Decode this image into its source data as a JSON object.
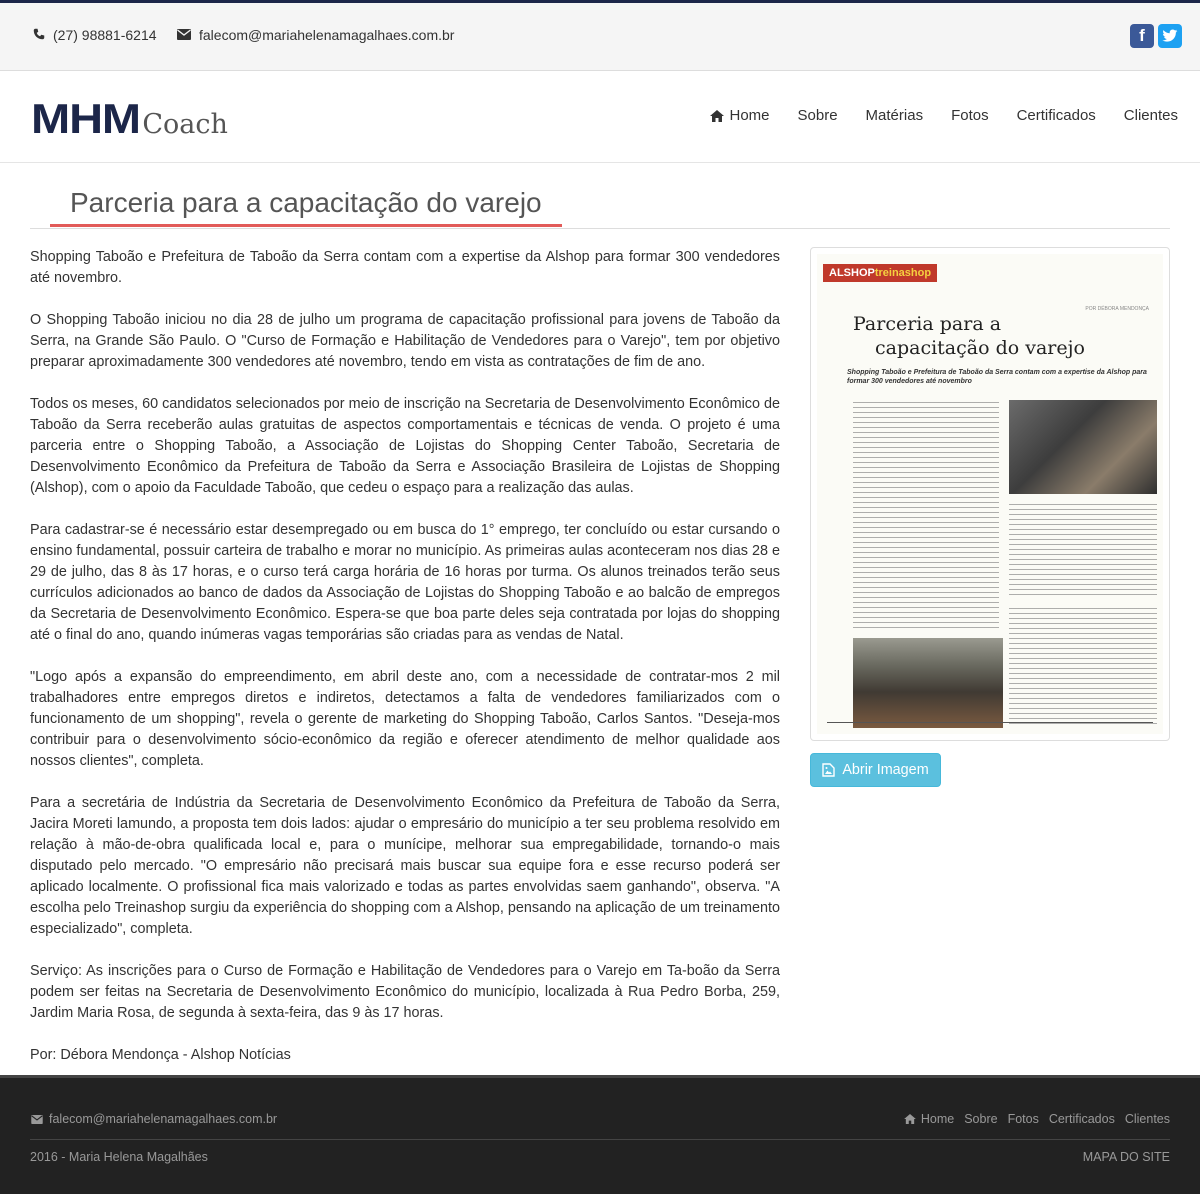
{
  "topbar": {
    "phone": "(27) 98881-6214",
    "email": "falecom@mariahelenamagalhaes.com.br",
    "social": [
      "facebook-icon",
      "twitter-icon"
    ],
    "colors": {
      "facebook": "#3b5998",
      "twitter": "#1da1f2"
    }
  },
  "logo": {
    "mark": "MHM",
    "text": "Coach"
  },
  "nav": {
    "items": [
      {
        "label": "Home",
        "icon": "home-icon"
      },
      {
        "label": "Sobre"
      },
      {
        "label": "Matérias"
      },
      {
        "label": "Fotos"
      },
      {
        "label": "Certificados"
      },
      {
        "label": "Clientes"
      }
    ]
  },
  "page": {
    "title": "Parceria para a capacitação do varejo",
    "paragraphs": [
      "Shopping Taboão e Prefeitura de Taboão da Serra contam com a expertise da Alshop para formar 300 vendedores até novembro.",
      "O Shopping Taboão iniciou no dia 28 de julho um programa de capacitação profissional para jovens de Taboão da Serra, na Grande São Paulo. O \"Curso de Formação e Habilitação de Vendedores para o Varejo\", tem por objetivo preparar aproximadamente 300 vendedores até novembro, tendo em vista as contratações de fim de ano.",
      "Todos os meses, 60 candidatos selecionados por meio de inscrição na Secretaria de Desenvolvimento Econômico de Taboão da Serra receberão aulas gratuitas de aspectos comportamentais e técnicas de venda. O projeto é uma parceria entre o Shopping Taboão, a Associação de Lojistas do Shopping Center Taboão, Secretaria de Desenvolvimento Econômico da Prefeitura de Taboão da Serra e Associação Brasileira de Lojistas de Shopping (Alshop), com o apoio da Faculdade Taboão, que cedeu o espaço para a realização das aulas.",
      "Para cadastrar-se é necessário estar desempregado ou em busca do 1° emprego, ter concluído ou estar cursando o ensino fundamental, possuir carteira de trabalho e morar no município. As primeiras aulas aconteceram nos dias 28 e 29 de julho, das 8 às 17 horas, e o curso terá carga horária de 16 horas por turma. Os alunos treinados terão seus currículos adicionados ao banco de dados da Associação de Lojistas do Shopping Taboão e ao balcão de empregos da Secretaria de Desenvolvimento Econômico. Espera-se que boa parte deles seja contratada por lojas do shopping até o final do ano, quando inúmeras vagas temporárias são criadas para as vendas de Natal.",
      "\"Logo após a expansão do empreendimento, em abril deste ano, com a necessidade de contratar-mos 2 mil trabalhadores entre empregos diretos e indiretos, detectamos a falta de vendedores familiarizados com o funcionamento de um shopping\", revela o gerente de marketing do Shopping Taboão, Carlos Santos. \"Deseja-mos contribuir para o desenvolvimento sócio-econômico da região e oferecer atendimento de melhor qualidade aos nossos clientes\", completa.",
      "Para a secretária de Indústria da Secretaria de Desenvolvimento Econômico da Prefeitura de Taboão da Serra, Jacira Moreti lamundo, a proposta tem dois lados: ajudar o empresário do município a ter seu problema resolvido em relação à mão-de-obra qualificada local e, para o munícipe, melhorar sua empregabilidade, tornando-o mais disputado pelo mercado. \"O empresário não precisará mais buscar sua equipe fora e esse recurso poderá ser aplicado localmente. O profissional fica mais valorizado e todas as partes envolvidas saem ganhando\", observa. \"A escolha pelo Treinashop surgiu da experiência do shopping com a Alshop, pensando na aplicação de um treinamento especializado\", completa.",
      "Serviço: As inscrições para o Curso de Formação e Habilitação de Vendedores para o Varejo em Ta-boão da Serra podem ser feitas na Secretaria de Desenvolvimento Econômico do município, localizada à Rua Pedro Borba, 259, Jardim Maria Rosa, de segunda à sexta-feira, das 9 às 17 horas.",
      "Por: Débora Mendonça - Alshop Notícias"
    ]
  },
  "magazine": {
    "brand": "ALSHOP",
    "brand_sub": "treinashop",
    "byline": "POR DÉBORA MENDONÇA",
    "title_line1": "Parceria para a",
    "title_line2": "capacitação do varejo",
    "subtitle": "Shopping Taboão e Prefeitura de Taboão da Serra contam com a expertise da Alshop para formar 300 vendedores até novembro"
  },
  "button": {
    "label": "Abrir Imagem",
    "icon": "image-icon",
    "color": "#5bc0de"
  },
  "footer": {
    "email": "falecom@mariahelenamagalhaes.com.br",
    "nav": [
      "Home",
      "Sobre",
      "Fotos",
      "Certificados",
      "Clientes"
    ],
    "copyright": "2016 - Maria Helena Magalhães",
    "sitemap": "MAPA DO SITE"
  }
}
